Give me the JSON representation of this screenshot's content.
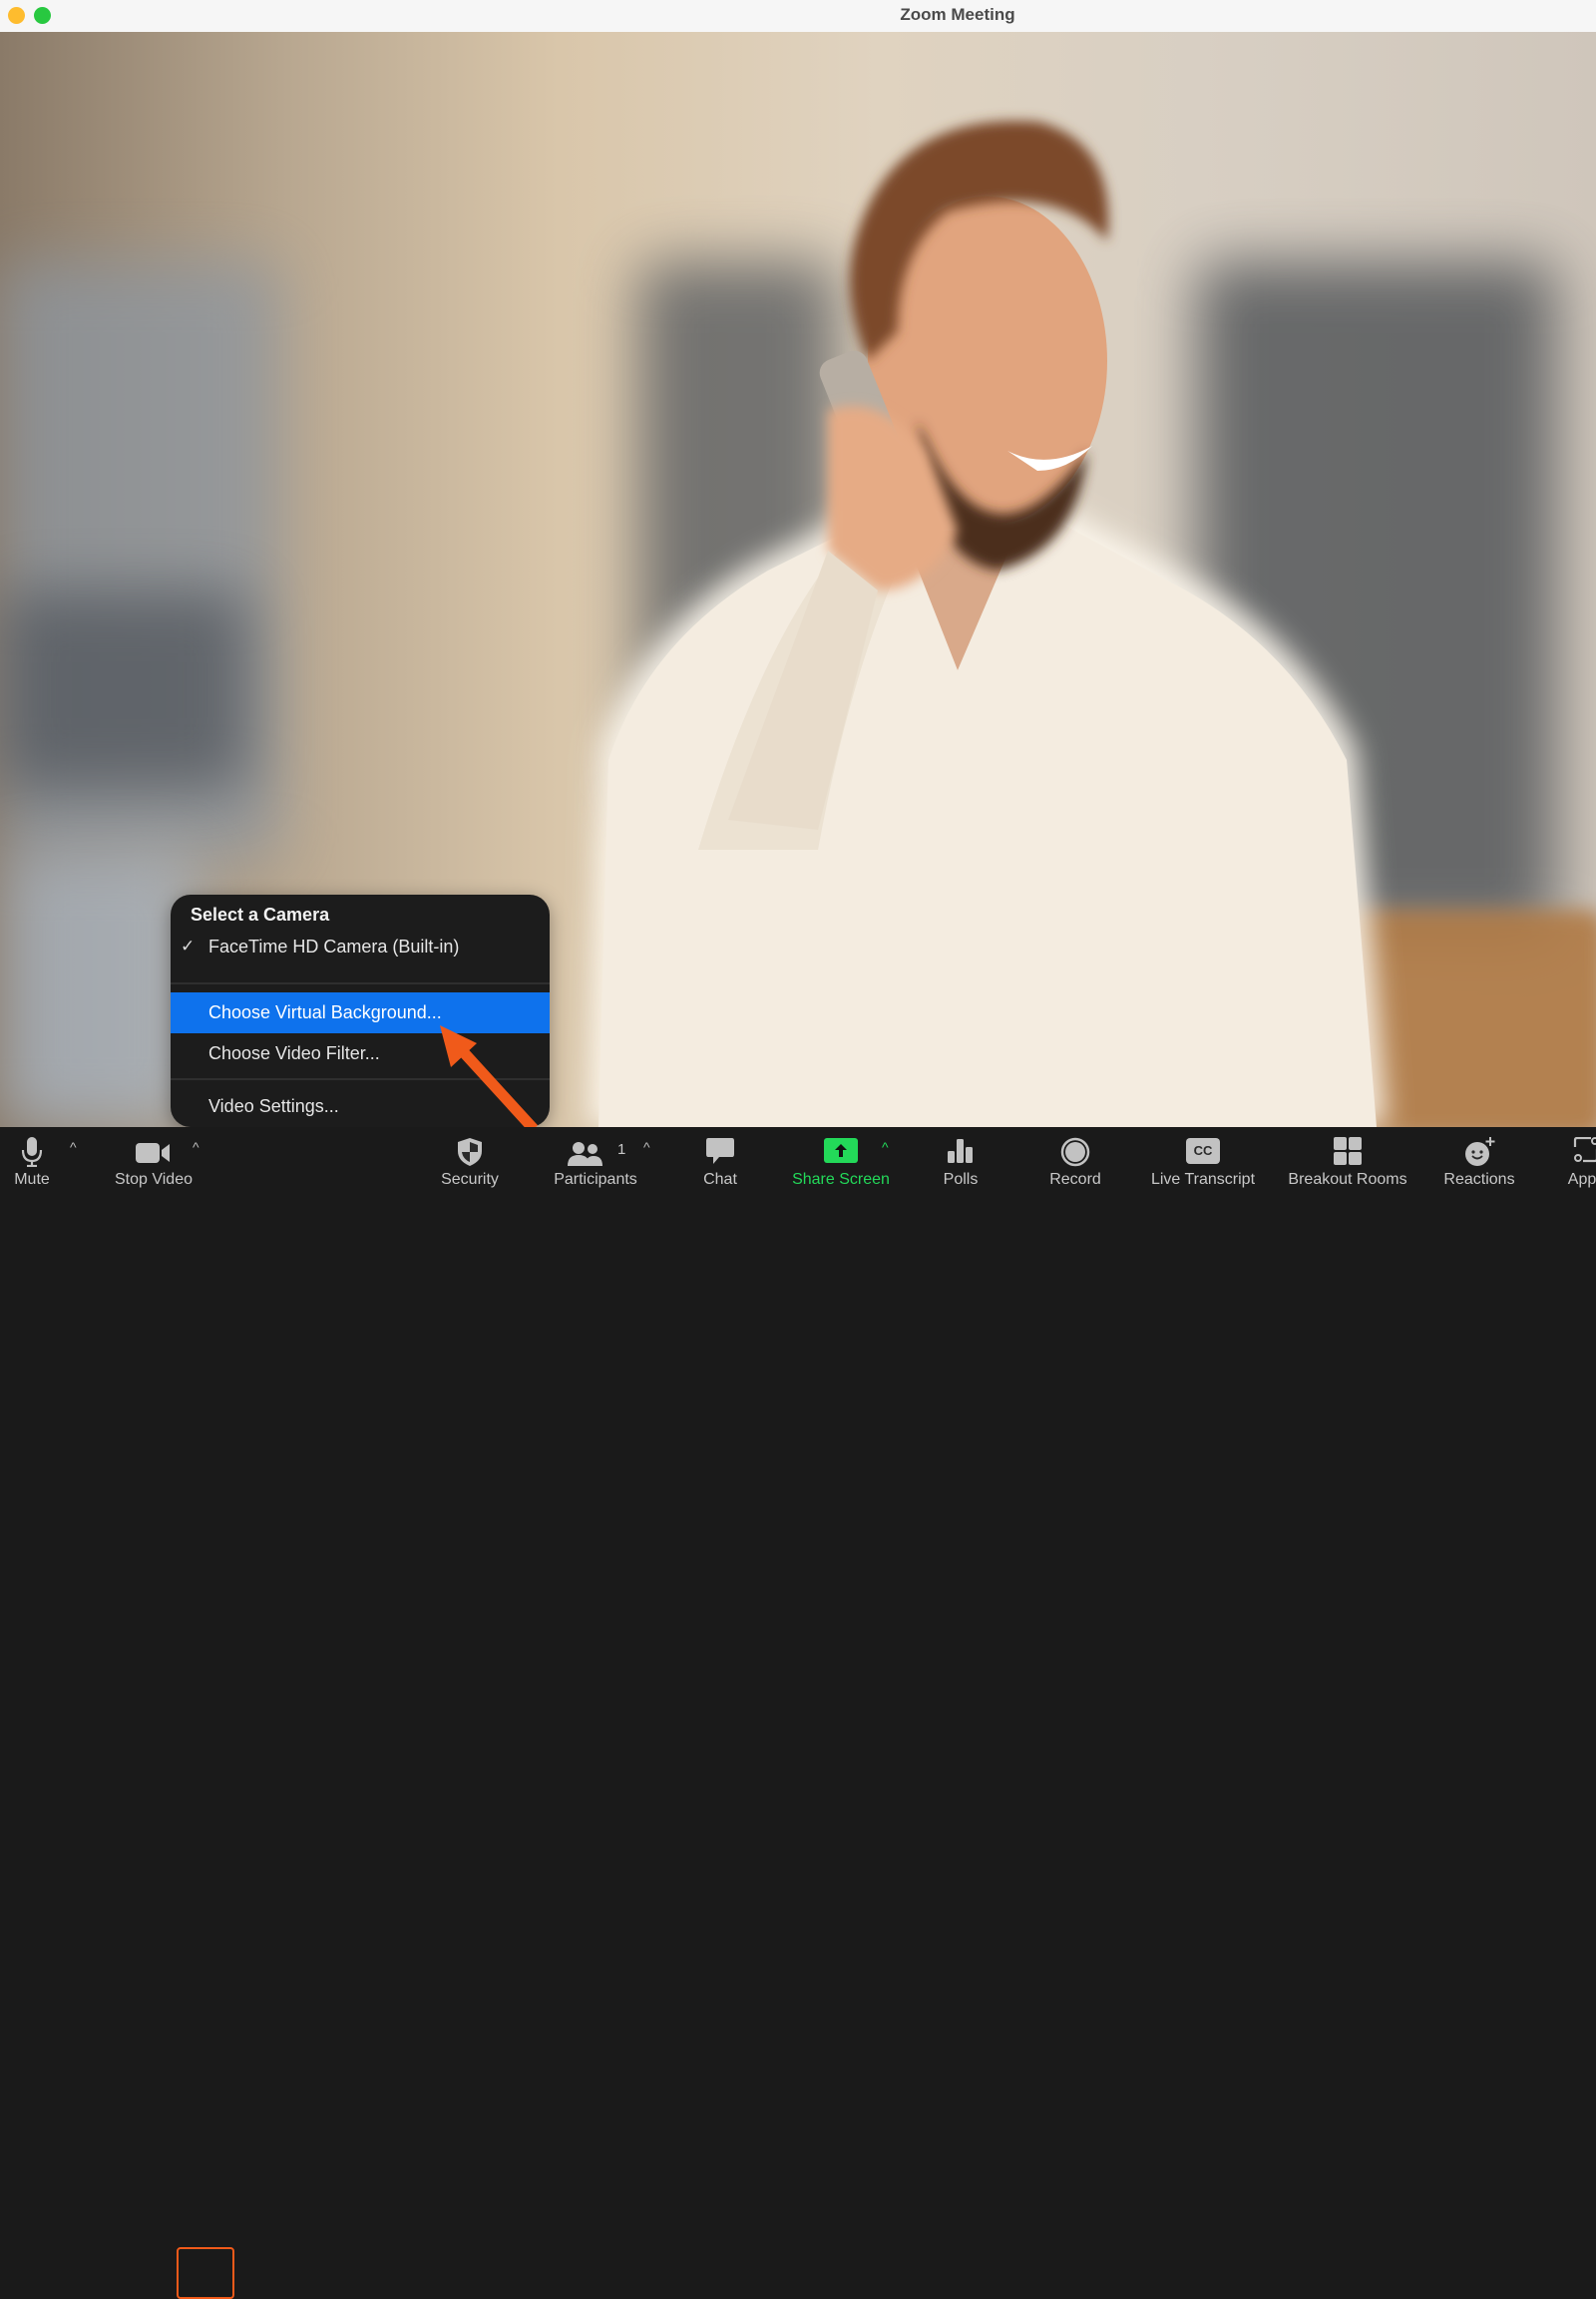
{
  "window": {
    "title": "Zoom Meeting",
    "traffic_lights": [
      {
        "name": "minimize",
        "color": "#febc2e"
      },
      {
        "name": "zoom",
        "color": "#28c840"
      }
    ]
  },
  "camera_menu": {
    "header": "Select a Camera",
    "cameras": [
      {
        "label": "FaceTime HD Camera (Built-in)",
        "selected": true,
        "check": "✓"
      }
    ],
    "items": [
      {
        "label": "Choose Virtual Background...",
        "highlighted": true
      },
      {
        "label": "Choose Video Filter...",
        "highlighted": false
      },
      {
        "label": "Video Settings...",
        "highlighted": false
      }
    ],
    "highlight_color": "#0e72ed"
  },
  "annotation": {
    "arrow_color": "#f05a1a",
    "box_color": "#f05a1a"
  },
  "toolbar": {
    "mute": {
      "label": "Mute",
      "icon": "microphone-icon"
    },
    "stop_video": {
      "label": "Stop Video",
      "icon": "video-camera-icon"
    },
    "security": {
      "label": "Security",
      "icon": "shield-icon"
    },
    "participants": {
      "label": "Participants",
      "icon": "people-icon",
      "count": "1"
    },
    "chat": {
      "label": "Chat",
      "icon": "chat-bubble-icon"
    },
    "share_screen": {
      "label": "Share Screen",
      "icon": "share-arrow-icon",
      "color": "#23d959"
    },
    "polls": {
      "label": "Polls",
      "icon": "bar-chart-icon"
    },
    "record": {
      "label": "Record",
      "icon": "record-icon"
    },
    "live_transcript": {
      "label": "Live Transcript",
      "icon": "cc-icon",
      "icon_text": "CC"
    },
    "breakout_rooms": {
      "label": "Breakout Rooms",
      "icon": "grid-icon"
    },
    "reactions": {
      "label": "Reactions",
      "icon": "smiley-plus-icon"
    },
    "apps": {
      "label": "Apps",
      "icon": "apps-icon"
    },
    "chevron": "^"
  }
}
